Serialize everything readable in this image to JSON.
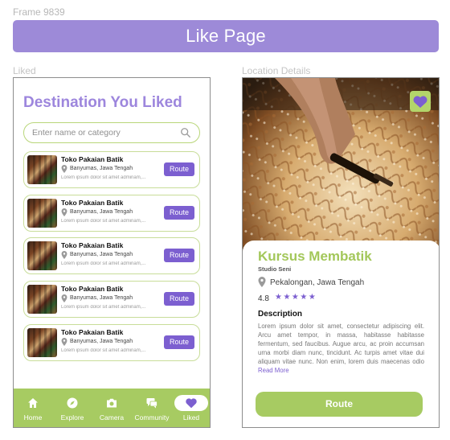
{
  "frame_label": "Frame 9839",
  "banner_title": "Like Page",
  "labels": {
    "liked": "Liked",
    "details": "Location Details"
  },
  "liked": {
    "title": "Destination You Liked",
    "search_placeholder": "Enter name or category",
    "items": [
      {
        "title": "Toko Pakaian Batik",
        "location": "Banyumas, Jawa Tengah",
        "desc": "Lorem ipsum dolor sit amet adminam,...",
        "button": "Route"
      },
      {
        "title": "Toko Pakaian Batik",
        "location": "Banyumas, Jawa Tengah",
        "desc": "Lorem ipsum dolor sit amet adminam,...",
        "button": "Route"
      },
      {
        "title": "Toko Pakaian Batik",
        "location": "Banyumas, Jawa Tengah",
        "desc": "Lorem ipsum dolor sit amet adminam,...",
        "button": "Route"
      },
      {
        "title": "Toko Pakaian Batik",
        "location": "Banyumas, Jawa Tengah",
        "desc": "Lorem ipsum dolor sit amet adminam,...",
        "button": "Route"
      },
      {
        "title": "Toko Pakaian Batik",
        "location": "Banyumas, Jawa Tengah",
        "desc": "Lorem ipsum dolor sit amet adminam,...",
        "button": "Route"
      }
    ],
    "nav": [
      {
        "label": "Home",
        "icon": "home-icon"
      },
      {
        "label": "Explore",
        "icon": "compass-icon"
      },
      {
        "label": "Camera",
        "icon": "camera-icon"
      },
      {
        "label": "Community",
        "icon": "chat-icon"
      },
      {
        "label": "Liked",
        "icon": "heart-icon",
        "active": true
      }
    ]
  },
  "details": {
    "title": "Kursus Membatik",
    "subtitle": "Studio Seni",
    "location": "Pekalongan, Jawa Tengah",
    "rating": "4.8",
    "stars": 5,
    "description_heading": "Description",
    "description": "Lorem ipsum dolor sit amet, consectetur adipiscing elit. Arcu amet tempor, in massa, habitasse habitasse fermentum, sed faucibus. Augue arcu, ac proin accumsan urna morbi diam nunc, tincidunt. Ac turpis amet vitae dui aliquam vitae nunc. Non enim, lorem duis maecenas odio",
    "read_more": "Read More",
    "route_button": "Route"
  },
  "colors": {
    "purple": "#7c5fd0",
    "lavender": "#9d8ad8",
    "green": "#a7cb62"
  }
}
